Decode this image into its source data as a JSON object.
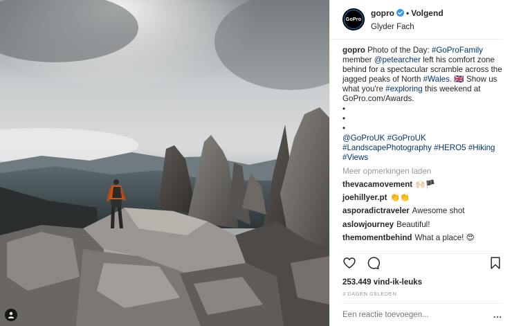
{
  "post": {
    "username": "gopro",
    "follow_status": "Volgend",
    "location": "Glyder Fach",
    "avatar_text": "GoPro",
    "caption": {
      "username": "gopro",
      "t1": "Photo of the Day: ",
      "tag1": "#GoProFamily",
      "t2": " member ",
      "mention": "@petearcher",
      "t3": " left his comfort zone behind for a spectacular scramble across the jagged peaks of North ",
      "tag2": "#Wales",
      "t4": ". 🇬🇧 Show us what you're ",
      "tag3": "#exploring",
      "t5": " this weekend at GoPro.com/Awards.",
      "bullets": [
        "•",
        "•",
        "•"
      ],
      "tags_line": [
        "@GoProUK",
        "#GoProUK",
        "#LandscapePhotography",
        "#HERO5",
        "#Hiking",
        "#Views"
      ]
    },
    "load_more": "Meer opmerkingen laden",
    "comments": [
      {
        "user": "thevacamovement",
        "text": "🙌🏻🏴"
      },
      {
        "user": "joehillyer.pt",
        "text": "👏👏"
      },
      {
        "user": "asporadictraveler",
        "text": "Awesome shot"
      },
      {
        "user": "aslowjourney",
        "text": "Beautiful!"
      },
      {
        "user": "themomentbehind",
        "text": "What a place! 😍"
      }
    ],
    "likes": "253.449 vind-ik-leuks",
    "time_ago": "3 DAGEN GELEDEN",
    "reply_placeholder": "Een reactie toevoegen...",
    "options_label": "..."
  },
  "colors": {
    "link": "#003569",
    "muted": "#999999",
    "verified": "#3897f0",
    "divider": "#efefef"
  },
  "icons": [
    "heart-icon",
    "comment-icon",
    "bookmark-icon",
    "verified-icon",
    "user-tag-icon"
  ]
}
